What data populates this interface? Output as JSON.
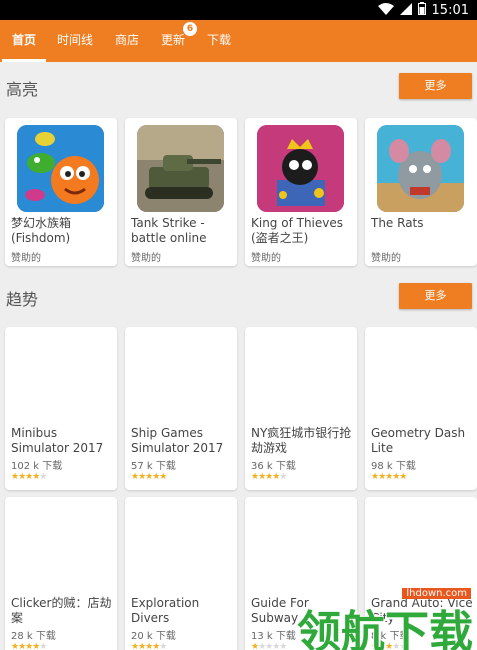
{
  "status_bar": {
    "time": "15:01"
  },
  "tabs": [
    {
      "label": "首页",
      "active": true
    },
    {
      "label": "时间线"
    },
    {
      "label": "商店"
    },
    {
      "label": "更新",
      "badge": "6"
    },
    {
      "label": "下载"
    }
  ],
  "sections": {
    "highlights": {
      "title": "高亮",
      "more_label": "更多"
    },
    "trending": {
      "title": "趋势",
      "more_label": "更多"
    }
  },
  "highlight_cards": [
    {
      "title": "梦幻水族箱 (Fishdom)",
      "sponsor": "赞助的",
      "icon": "fishdom-app-icon"
    },
    {
      "title": "Tank Strike - battle online",
      "sponsor": "赞助的",
      "icon": "tank-strike-app-icon"
    },
    {
      "title": "King of Thieves (盗者之王)",
      "sponsor": "赞助的",
      "icon": "king-of-thieves-app-icon"
    },
    {
      "title": "The Rats",
      "sponsor": "赞助的",
      "icon": "the-rats-app-icon"
    }
  ],
  "trending_cards_row1": [
    {
      "title": "Minibus Simulator 2017",
      "downloads": "102 k 下载",
      "rating": 3.5
    },
    {
      "title": "Ship Games Simulator 2017",
      "downloads": "57 k 下载",
      "rating": 4.5
    },
    {
      "title": "NY疯狂城市银行抢劫游戏",
      "downloads": "36 k 下载",
      "rating": 3.5
    },
    {
      "title": "Geometry Dash Lite",
      "downloads": "98 k 下载",
      "rating": 4.5
    }
  ],
  "trending_cards_row2": [
    {
      "title": "Clicker的贼：店劫案",
      "downloads": "28 k 下载"
    },
    {
      "title": "Exploration Divers",
      "downloads": "20 k 下载"
    },
    {
      "title": "Guide For Subway",
      "downloads": "13 k 下载"
    },
    {
      "title": "Grand Auto: Vice City",
      "downloads": "8 k 下载"
    }
  ],
  "watermark": {
    "site": "lhdown.com",
    "text": "领航下载"
  },
  "colors": {
    "accent": "#ef7d22",
    "star": "#f2b01e",
    "watermark_green": "#2fa93a"
  }
}
